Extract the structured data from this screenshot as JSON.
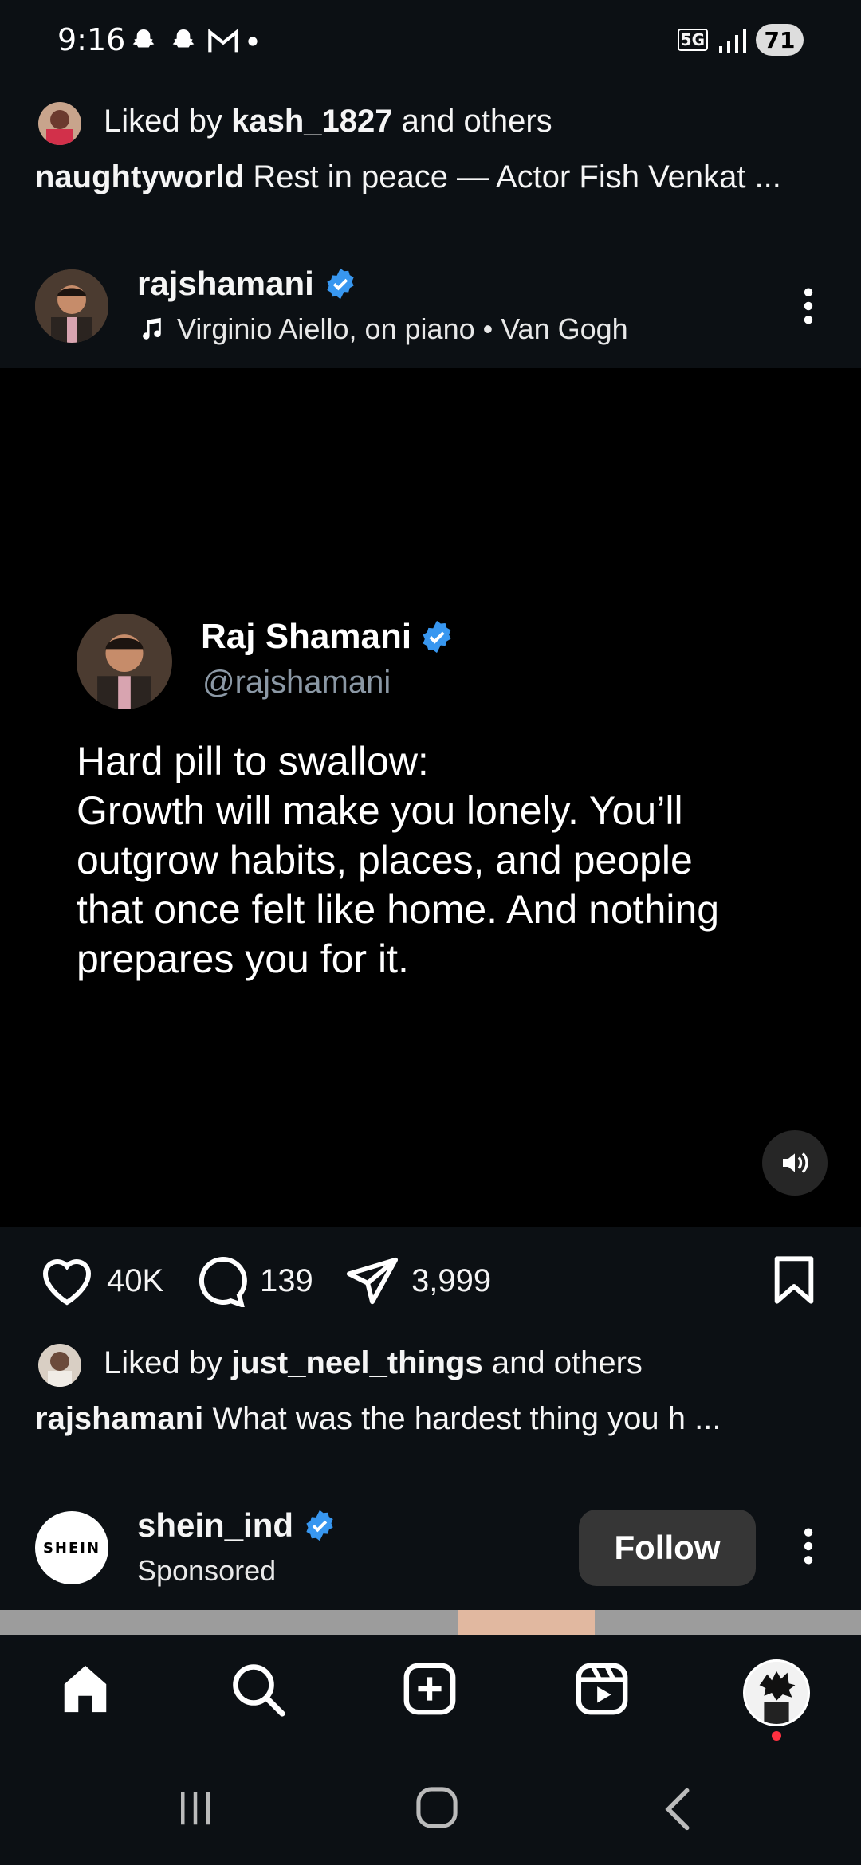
{
  "status_bar": {
    "time": "9:16",
    "battery": "71",
    "network": "5G"
  },
  "prev_post": {
    "liked_prefix": "Liked by",
    "liked_user": "kash_1827",
    "liked_suffix": "and others",
    "caption_user": "naughtyworld",
    "caption_text": "Rest in peace — Actor Fish Venkat ..."
  },
  "post": {
    "username": "rajshamani",
    "audio": "Virginio Aiello, on piano • Van Gogh",
    "tweet": {
      "name": "Raj Shamani",
      "handle": "@rajshamani",
      "body": "Hard pill to swallow:\nGrowth will make you lonely. You’ll\noutgrow habits, places, and people\nthat once felt like home. And nothing\nprepares you for it."
    },
    "likes": "40K",
    "comments": "139",
    "shares": "3,999",
    "liked_prefix": "Liked by",
    "liked_user": "just_neel_things",
    "liked_suffix": "and others",
    "caption_user": "rajshamani",
    "caption_text": "What was the hardest thing you h ..."
  },
  "sponsored": {
    "username": "shein_ind",
    "label": "Sponsored",
    "logo_text": "SHEIN",
    "follow_label": "Follow"
  },
  "colors": {
    "verified": "#3897f0",
    "bg": "#0c1014",
    "media_bg": "#000000"
  }
}
